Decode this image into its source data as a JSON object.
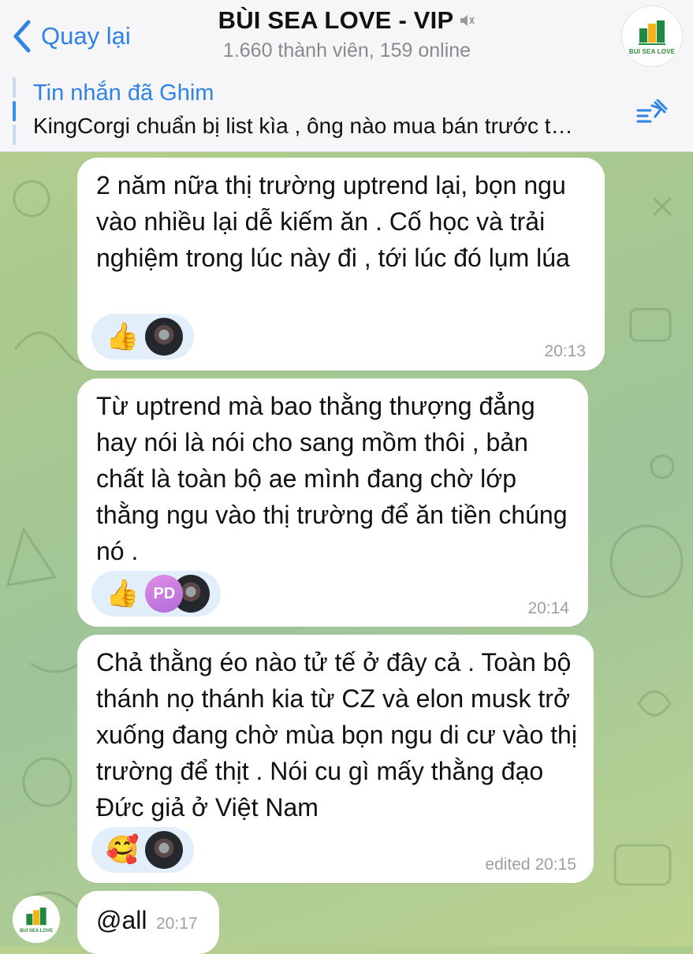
{
  "header": {
    "back_label": "Quay lại",
    "title": "BÙI SEA LOVE - VIP",
    "subtitle": "1.660 thành viên, 159 online",
    "avatar_brand": "BUI SEA LOVE",
    "muted": true
  },
  "pinned": {
    "title": "Tin nhắn đã Ghim",
    "text": "KingCorgi chuẩn bị list kìa  , ông nào mua bán trước t…"
  },
  "messages": [
    {
      "text": "2 năm nữa thị trường uptrend lại, bọn ngu vào nhiều lại dễ kiếm ăn . Cố học và trải nghiệm trong lúc này đi , tới lúc đó lụm lúa",
      "reaction_emoji": "👍",
      "reactor_initials": [],
      "time": "20:13"
    },
    {
      "text": "Từ uptrend mà bao thằng thượng đẳng hay nói là nói cho sang mồm thôi , bản chất là toàn bộ ae mình đang chờ lớp thằng ngu vào thị trường để ăn tiền chúng nó .",
      "reaction_emoji": "👍",
      "reactor_initials": [
        "PD"
      ],
      "time": "20:14"
    },
    {
      "text": "Chả thằng éo nào tử tế ở đây cả . Toàn bộ thánh nọ thánh kia từ CZ và elon musk trở xuống đang chờ mùa bọn ngu di cư vào thị trường để thịt . Nói cu gì mấy thằng đạo Đức giả ở Việt Nam",
      "reaction_emoji": "🥰",
      "reactor_initials": [],
      "time": "edited 20:15"
    },
    {
      "text": "@all",
      "time": "20:17"
    }
  ],
  "sender_avatar_brand": "BUI SEA LOVE"
}
